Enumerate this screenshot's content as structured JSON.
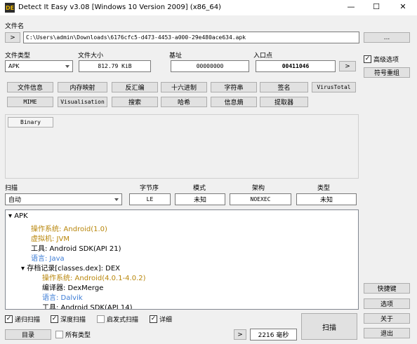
{
  "window": {
    "title": "Detect It Easy v3.08 [Windows 10 Version 2009] (x86_64)",
    "logo_text": "DE",
    "minimize": "—",
    "maximize": "☐",
    "close": "✕"
  },
  "file": {
    "label": "文件名",
    "nav_button": ">",
    "path": "C:\\Users\\admin\\Downloads\\6176cfc5-d473-4453-a000-29e480ace634.apk",
    "browse_button": "..."
  },
  "info": {
    "type_label": "文件类型",
    "type_value": "APK",
    "size_label": "文件大小",
    "size_value": "812.79 KiB",
    "base_label": "基址",
    "base_value": "00000000",
    "entry_label": "入口点",
    "entry_value": "00411046",
    "entry_button": ">"
  },
  "right_panel": {
    "advanced_label": "高级选项",
    "advanced_checked": true,
    "check_mark": "✓",
    "symbols_button": "符号重组",
    "shortcuts_button": "快捷键",
    "options_button": "选项",
    "about_button": "关于",
    "exit_button": "退出"
  },
  "tools": {
    "row1": [
      "文件信息",
      "内存映射",
      "反汇编",
      "十六进制",
      "字符串",
      "签名",
      "VirusTotal"
    ],
    "row2": [
      "MIME",
      "Visualisation",
      "搜索",
      "哈希",
      "信息熵",
      "提取器"
    ]
  },
  "binary_tab": "Binary",
  "scan": {
    "label": "扫描",
    "mode_value": "自动",
    "endian_label": "字节序",
    "endian_value": "LE",
    "mode_label": "模式",
    "mode_field_value": "未知",
    "arch_label": "架构",
    "arch_value": "NOEXEC",
    "type_label": "类型",
    "type_value": "未知"
  },
  "tree": [
    {
      "prefix": "▾ ",
      "text": "APK",
      "color": "blk"
    },
    {
      "prefix": "",
      "text": "操作系统: Android(1.0)",
      "color": "gold"
    },
    {
      "prefix": "",
      "text": "虚拟机: JVM",
      "color": "gold"
    },
    {
      "prefix": "",
      "text": "工具: Android SDK(API 21)",
      "color": "blk"
    },
    {
      "prefix": "",
      "text": "语言: Java",
      "color": "blue"
    },
    {
      "prefix": "▾ ",
      "text": "存档记录[classes.dex]: DEX",
      "color": "blk"
    },
    {
      "prefix": "",
      "text": "操作系统: Android(4.0.1-4.0.2)",
      "color": "gold"
    },
    {
      "prefix": "",
      "text": "编译器: DexMerge",
      "color": "blk"
    },
    {
      "prefix": "",
      "text": "语言: Dalvik",
      "color": "blue"
    },
    {
      "prefix": "",
      "text": "工具: Android SDK(API 14)",
      "color": "blk"
    }
  ],
  "bottom": {
    "recursive_label": "递归扫描",
    "recursive_checked": true,
    "deep_label": "深度扫描",
    "deep_checked": true,
    "heuristic_label": "启发式扫描",
    "heuristic_checked": false,
    "verbose_label": "详细",
    "verbose_checked": true,
    "dir_button": "目录",
    "all_types_label": "所有类型",
    "all_types_checked": false,
    "nav_button": ">",
    "time_value": "2216 毫秒",
    "scan_button": "扫描"
  },
  "colors": {
    "gold": "#b8860b",
    "blue": "#3a7bd5",
    "button_bg": "#e1e1e1",
    "panel_bg": "#f0f0f0"
  }
}
